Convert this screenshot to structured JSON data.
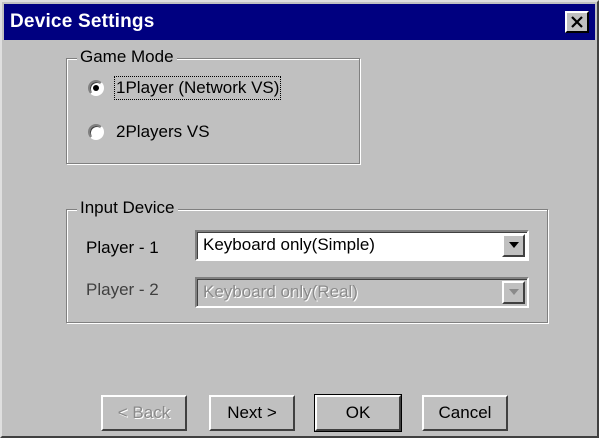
{
  "window": {
    "title": "Device Settings",
    "close_icon": "close-icon"
  },
  "game_mode": {
    "legend": "Game Mode",
    "options": [
      {
        "label": "1Player (Network VS)",
        "selected": true
      },
      {
        "label": "2Players VS",
        "selected": false
      }
    ]
  },
  "input_device": {
    "legend": "Input Device",
    "player1": {
      "label": "Player - 1",
      "value": "Keyboard only(Simple)",
      "enabled": true
    },
    "player2": {
      "label": "Player - 2",
      "value": "Keyboard only(Real)",
      "enabled": false
    }
  },
  "buttons": {
    "back": {
      "label": "< Back",
      "enabled": false
    },
    "next": {
      "label": "Next >",
      "enabled": true
    },
    "ok": {
      "label": "OK",
      "enabled": true
    },
    "cancel": {
      "label": "Cancel",
      "enabled": true
    }
  },
  "colors": {
    "face": "#c0c0c0",
    "titlebar": "#000080"
  }
}
